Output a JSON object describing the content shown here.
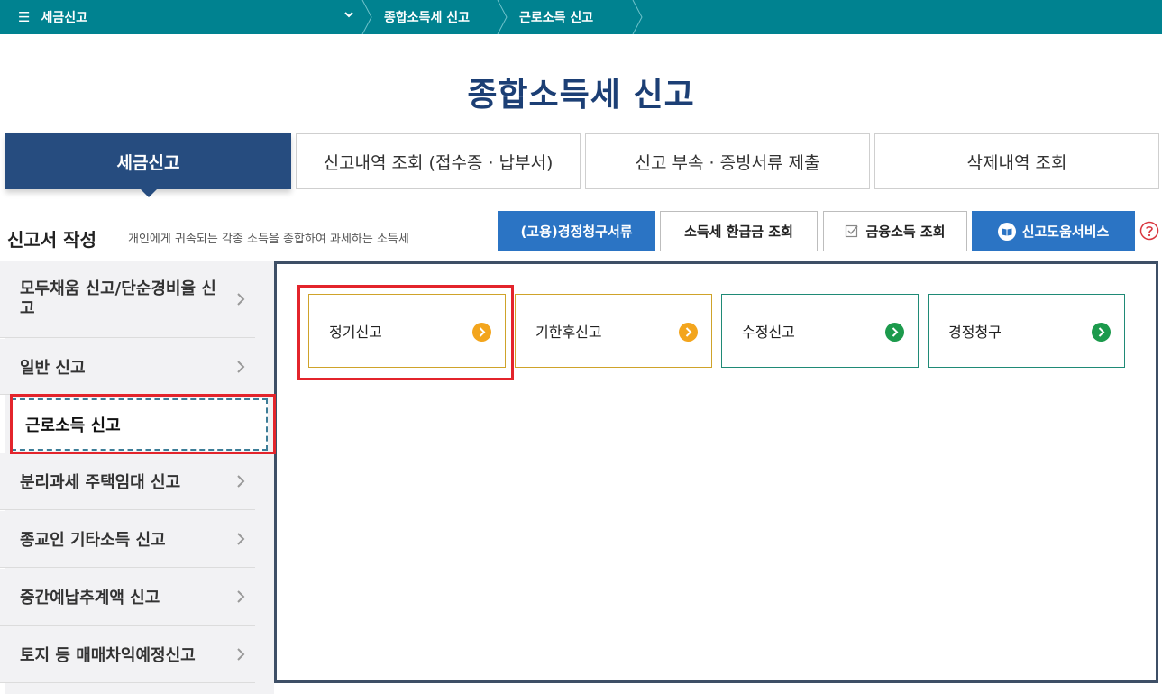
{
  "topbar": {
    "menu_label": "세금신고",
    "breadcrumbs": [
      "종합소득세 신고",
      "근로소득 신고"
    ]
  },
  "page": {
    "title": "종합소득세 신고"
  },
  "tabs": [
    {
      "label": "세금신고",
      "active": true
    },
    {
      "label": "신고내역 조회 (접수증 · 납부서)",
      "active": false
    },
    {
      "label": "신고 부속 · 증빙서류 제출",
      "active": false
    },
    {
      "label": "삭제내역 조회",
      "active": false
    }
  ],
  "section": {
    "title": "신고서 작성",
    "description": "개인에게 귀속되는 각종 소득을 종합하여 과세하는 소득세"
  },
  "actions": [
    {
      "label": "(고용)경정청구서류",
      "style": "blue"
    },
    {
      "label": "소득세 환급금 조회",
      "style": "outline"
    },
    {
      "label": "금융소득 조회",
      "style": "outline",
      "icon": "checkbox-icon"
    },
    {
      "label": "신고도움서비스",
      "style": "blue",
      "icon": "book-icon"
    }
  ],
  "help": {
    "icon": "question-icon"
  },
  "left_menu": [
    {
      "label": "모두채움 신고/단순경비율 신고",
      "selected": false
    },
    {
      "label": "일반 신고",
      "selected": false
    },
    {
      "label": "근로소득 신고",
      "selected": true
    },
    {
      "label": "분리과세 주택임대 신고",
      "selected": false
    },
    {
      "label": "종교인 기타소득 신고",
      "selected": false
    },
    {
      "label": "중간예납추계액 신고",
      "selected": false
    },
    {
      "label": "토지 등 매매차익예정신고",
      "selected": false
    }
  ],
  "cards": [
    {
      "label": "정기신고",
      "color": "#f3a51d"
    },
    {
      "label": "기한후신고",
      "color": "#f3a51d"
    },
    {
      "label": "수정신고",
      "color": "#1c9a4c"
    },
    {
      "label": "경정청구",
      "color": "#1c9a4c"
    }
  ],
  "colors": {
    "topbar": "#008290",
    "title": "#1c3f75",
    "active_tab": "#264c7f",
    "blue_button": "#2b74c4",
    "highlight": "#e3242b"
  }
}
